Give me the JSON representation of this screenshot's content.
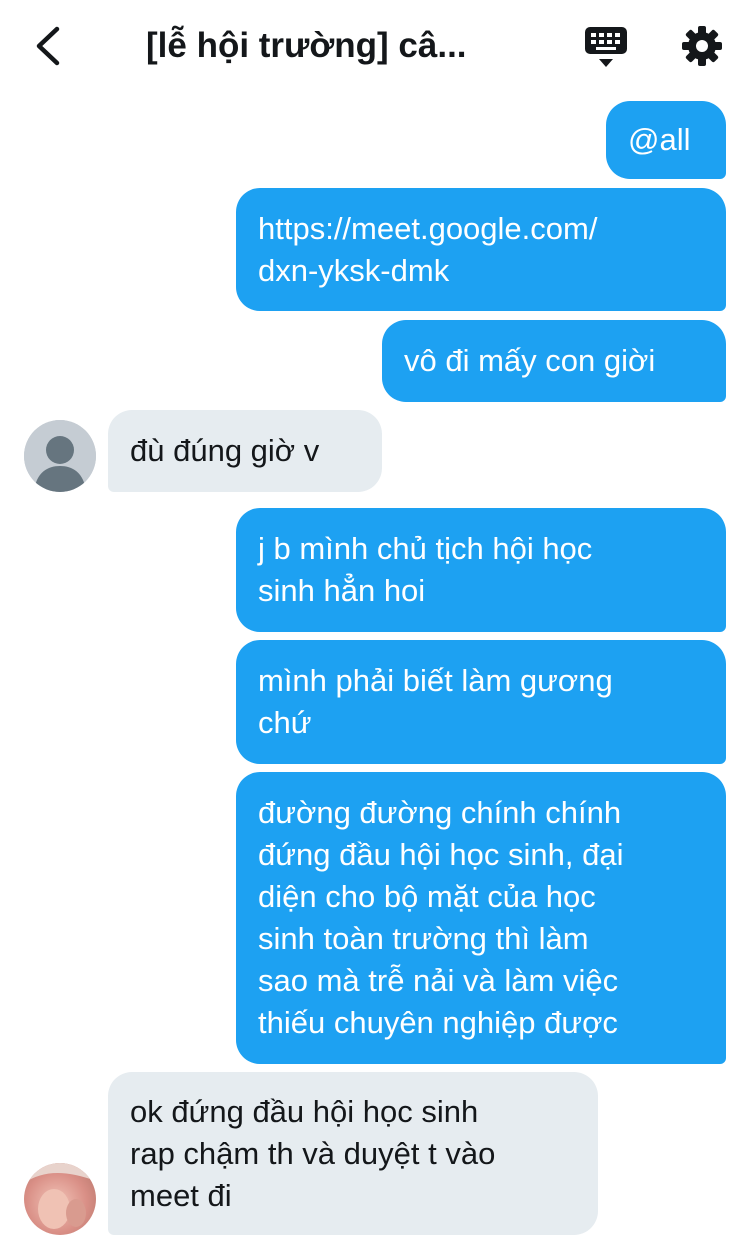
{
  "header": {
    "title": "[lễ hội trường] câ...",
    "back_icon": "chevron-left-icon",
    "keyboard_icon": "keyboard-icon",
    "settings_icon": "gear-icon"
  },
  "messages": [
    {
      "side": "out",
      "text": "@all"
    },
    {
      "side": "out",
      "text": "https://meet.google.com/\ndxn-yksk-dmk"
    },
    {
      "side": "out",
      "text": "vô đi mấy con giời"
    },
    {
      "side": "in",
      "text": "đù đúng giờ v"
    },
    {
      "side": "out",
      "text": "j b mình chủ tịch hội học\nsinh hẳn hoi"
    },
    {
      "side": "out",
      "text": "mình phải biết làm gương\nchứ"
    },
    {
      "side": "out",
      "text": "đường đường chính chính\nđứng đầu hội học sinh, đại\ndiện cho bộ mặt của học\nsinh toàn trường thì làm\nsao mà trễ nải và làm việc\nthiếu chuyên nghiệp được"
    },
    {
      "side": "in",
      "text": "ok đứng đầu hội học sinh\nrap chậm th và duyệt t vào\nmeet đi"
    }
  ],
  "colors": {
    "outgoing_bubble": "#1da1f2",
    "incoming_bubble": "#e6ecf0",
    "header_text": "#14171a"
  }
}
